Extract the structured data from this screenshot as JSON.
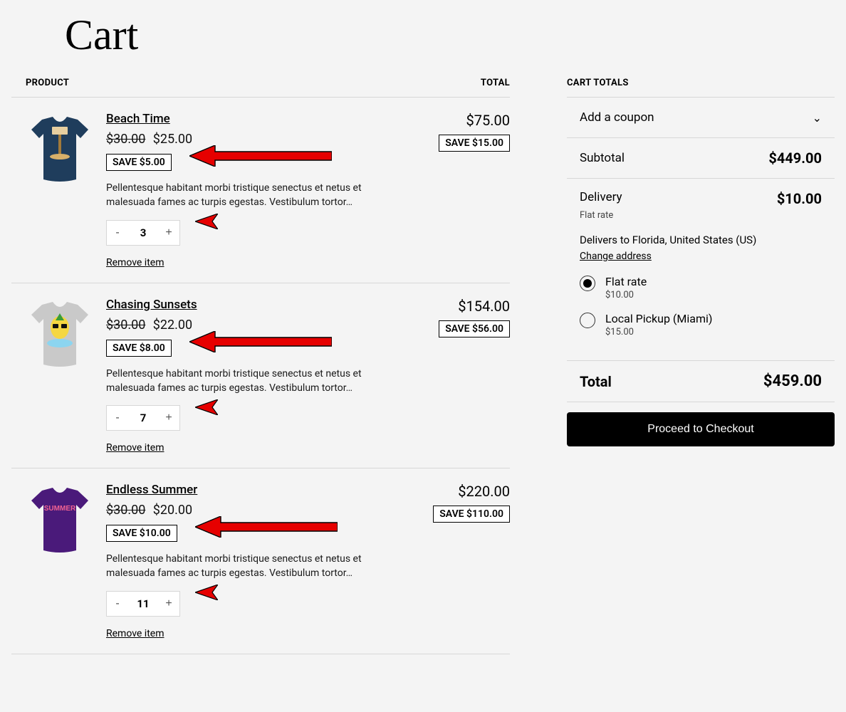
{
  "title": "Cart",
  "headers": {
    "product": "PRODUCT",
    "total": "TOTAL"
  },
  "remove_label": "Remove item",
  "desc_text": "Pellentesque habitant morbi tristique senectus et netus et malesuada fames ac turpis egestas. Vestibulum tortor…",
  "items": [
    {
      "name": "Beach Time",
      "orig_price": "$30.00",
      "sale_price": "$25.00",
      "save_unit": "SAVE $5.00",
      "qty": "3",
      "line_total": "$75.00",
      "save_total": "SAVE $15.00",
      "shirt_color": "#1f3d5c"
    },
    {
      "name": "Chasing Sunsets",
      "orig_price": "$30.00",
      "sale_price": "$22.00",
      "save_unit": "SAVE $8.00",
      "qty": "7",
      "line_total": "$154.00",
      "save_total": "SAVE $56.00",
      "shirt_color": "#c9c9c9"
    },
    {
      "name": "Endless Summer",
      "orig_price": "$30.00",
      "sale_price": "$20.00",
      "save_unit": "SAVE $10.00",
      "qty": "11",
      "line_total": "$220.00",
      "save_total": "SAVE $110.00",
      "shirt_color": "#4a1a7a"
    }
  ],
  "totals": {
    "header": "CART TOTALS",
    "coupon_label": "Add a coupon",
    "subtotal_label": "Subtotal",
    "subtotal": "$449.00",
    "delivery_label": "Delivery",
    "delivery_amount": "$10.00",
    "flat_rate_sub": "Flat rate",
    "delivers_to": "Delivers to Florida, United States (US)",
    "change_address": "Change address",
    "shipping": [
      {
        "name": "Flat rate",
        "cost": "$10.00",
        "checked": true
      },
      {
        "name": "Local Pickup (Miami)",
        "cost": "$15.00",
        "checked": false
      }
    ],
    "total_label": "Total",
    "total": "$459.00",
    "checkout_label": "Proceed to Checkout"
  }
}
